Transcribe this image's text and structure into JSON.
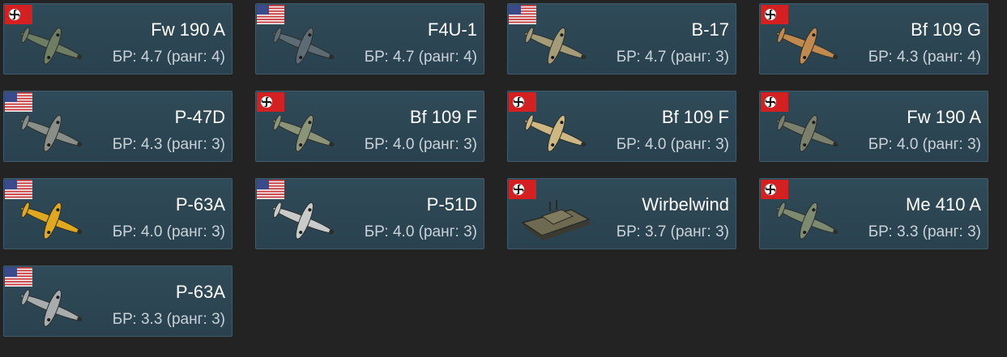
{
  "cards": [
    {
      "name": "Fw 190 A",
      "info": "БР: 4.7 (ранг: 4)",
      "flag": "germany-flag-icon",
      "vehicle": "fw190-plane-icon",
      "flag_colors": {
        "field": "#d42020",
        "disc": "#ffffff",
        "cross": "#111111"
      },
      "vehicle_color": "#6f7d63"
    },
    {
      "name": "F4U-1",
      "info": "БР: 4.7 (ранг: 4)",
      "flag": "usa-flag-icon",
      "vehicle": "f4u-plane-icon",
      "flag_colors": {
        "stripe": "#c8393b",
        "white": "#f4f4f4",
        "canton": "#3a4a8a"
      },
      "vehicle_color": "#5d6b74"
    },
    {
      "name": "B-17",
      "info": "БР: 4.7 (ранг: 3)",
      "flag": "usa-flag-icon",
      "vehicle": "b17-bomber-icon",
      "flag_colors": {
        "stripe": "#c8393b",
        "white": "#f4f4f4",
        "canton": "#3a4a8a"
      },
      "vehicle_color": "#a49c78"
    },
    {
      "name": "Bf 109 G",
      "info": "БР: 4.3 (ранг: 4)",
      "flag": "germany-flag-icon",
      "vehicle": "bf109g-plane-icon",
      "flag_colors": {
        "field": "#d42020",
        "disc": "#ffffff",
        "cross": "#111111"
      },
      "vehicle_color": "#c08a4e"
    },
    {
      "name": "P-47D",
      "info": "БР: 4.3 (ранг: 3)",
      "flag": "usa-flag-icon",
      "vehicle": "p47-plane-icon",
      "flag_colors": {
        "stripe": "#c8393b",
        "white": "#f4f4f4",
        "canton": "#3a4a8a"
      },
      "vehicle_color": "#8a8e88"
    },
    {
      "name": "Bf 109 F",
      "info": "БР: 4.0 (ранг: 3)",
      "flag": "germany-flag-icon",
      "vehicle": "bf109f-plane-icon",
      "flag_colors": {
        "field": "#d42020",
        "disc": "#ffffff",
        "cross": "#111111"
      },
      "vehicle_color": "#8c9478"
    },
    {
      "name": "Bf 109 F",
      "info": "БР: 4.0 (ранг: 3)",
      "flag": "germany-flag-icon",
      "vehicle": "bf109f-desert-plane-icon",
      "flag_colors": {
        "field": "#d42020",
        "disc": "#ffffff",
        "cross": "#111111"
      },
      "vehicle_color": "#cdb883"
    },
    {
      "name": "Fw 190 A",
      "info": "БР: 4.0 (ранг: 3)",
      "flag": "germany-flag-icon",
      "vehicle": "fw190-plane-icon",
      "flag_colors": {
        "field": "#d42020",
        "disc": "#ffffff",
        "cross": "#111111"
      },
      "vehicle_color": "#7a806c"
    },
    {
      "name": "P-63A",
      "info": "БР: 4.0 (ранг: 3)",
      "flag": "usa-flag-icon",
      "vehicle": "p63-yellow-plane-icon",
      "flag_colors": {
        "stripe": "#c8393b",
        "white": "#f4f4f4",
        "canton": "#3a4a8a"
      },
      "vehicle_color": "#e0a81e"
    },
    {
      "name": "P-51D",
      "info": "БР: 4.0 (ранг: 3)",
      "flag": "usa-flag-icon",
      "vehicle": "p51-plane-icon",
      "flag_colors": {
        "stripe": "#c8393b",
        "white": "#f4f4f4",
        "canton": "#3a4a8a"
      },
      "vehicle_color": "#c9cbcb"
    },
    {
      "name": "Wirbelwind",
      "info": "БР: 3.7 (ранг: 3)",
      "flag": "germany-flag-icon",
      "vehicle": "wirbelwind-tank-icon",
      "flag_colors": {
        "field": "#d42020",
        "disc": "#ffffff",
        "cross": "#111111"
      },
      "vehicle_color": "#6e6a52"
    },
    {
      "name": "Me 410 A",
      "info": "БР: 3.3 (ранг: 3)",
      "flag": "germany-flag-icon",
      "vehicle": "me410-plane-icon",
      "flag_colors": {
        "field": "#d42020",
        "disc": "#ffffff",
        "cross": "#111111"
      },
      "vehicle_color": "#7d8a6f"
    },
    {
      "name": "P-63A",
      "info": "БР: 3.3 (ранг: 3)",
      "flag": "usa-flag-icon",
      "vehicle": "p63-plane-icon",
      "flag_colors": {
        "stripe": "#c8393b",
        "white": "#f4f4f4",
        "canton": "#3a4a8a"
      },
      "vehicle_color": "#a8acac"
    }
  ]
}
